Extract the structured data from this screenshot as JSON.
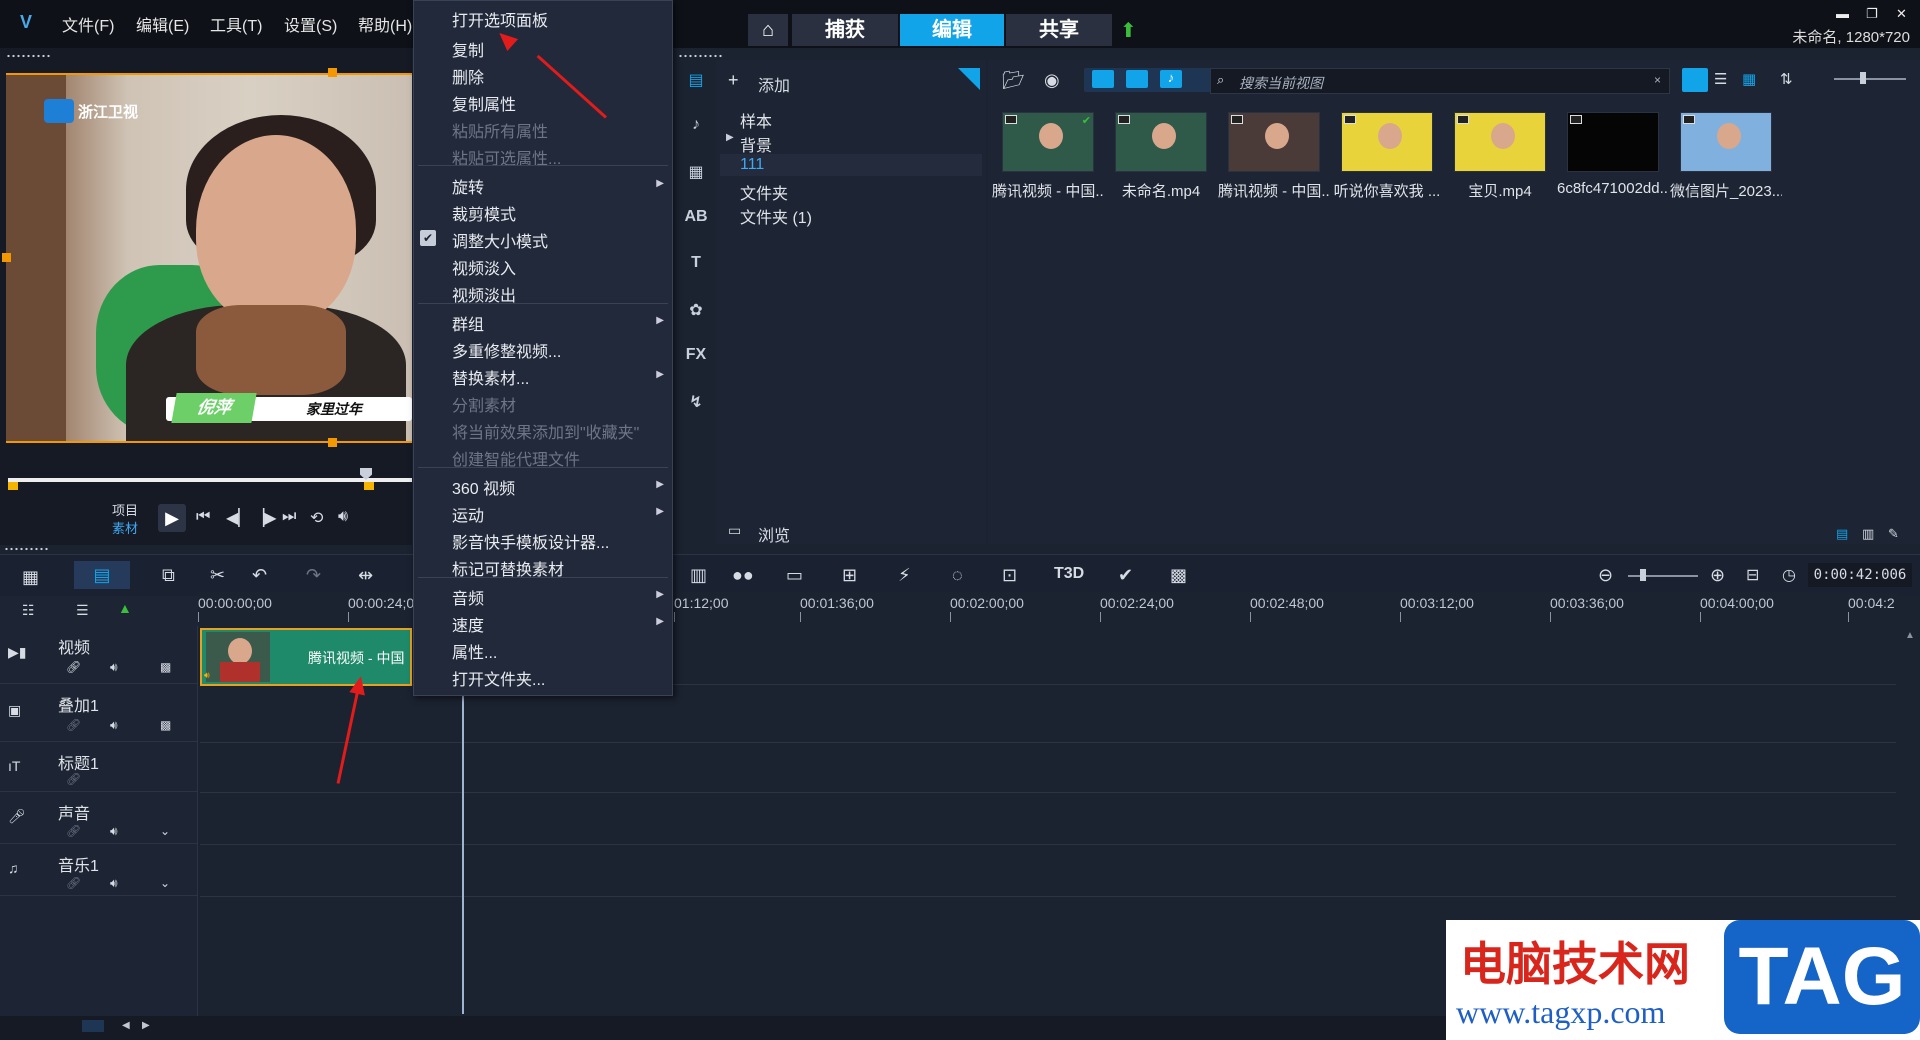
{
  "menubar": {
    "items": [
      "文件(F)",
      "编辑(E)",
      "工具(T)",
      "设置(S)",
      "帮助(H)"
    ]
  },
  "tabs": {
    "capture": "捕获",
    "edit": "编辑",
    "share": "共享"
  },
  "window": {
    "status": "未命名, 1280*720"
  },
  "preview": {
    "station": "浙江卫视",
    "caption_name": "倪萍",
    "caption_text": "家里过年",
    "label_project": "项目",
    "label_clip": "素材"
  },
  "context_menu": {
    "items": [
      {
        "label": "打开选项面板",
        "disabled": false
      },
      {
        "label": "复制",
        "disabled": false
      },
      {
        "label": "删除",
        "disabled": false
      },
      {
        "label": "复制属性",
        "disabled": false
      },
      {
        "label": "粘贴所有属性",
        "disabled": true
      },
      {
        "label": "粘贴可选属性...",
        "disabled": true
      },
      {
        "label": "旋转",
        "disabled": false,
        "submenu": true
      },
      {
        "label": "裁剪模式",
        "disabled": false
      },
      {
        "label": "调整大小模式",
        "disabled": false,
        "checked": true
      },
      {
        "label": "视频淡入",
        "disabled": false
      },
      {
        "label": "视频淡出",
        "disabled": false
      },
      {
        "label": "群组",
        "disabled": false,
        "submenu": true
      },
      {
        "label": "多重修整视频...",
        "disabled": false
      },
      {
        "label": "替换素材...",
        "disabled": false,
        "submenu": true
      },
      {
        "label": "分割素材",
        "disabled": true
      },
      {
        "label": "将当前效果添加到\"收藏夹\"",
        "disabled": true
      },
      {
        "label": "创建智能代理文件",
        "disabled": true
      },
      {
        "label": "360 视频",
        "disabled": false,
        "submenu": true
      },
      {
        "label": "运动",
        "disabled": false,
        "submenu": true
      },
      {
        "label": "影音快手模板设计器...",
        "disabled": false
      },
      {
        "label": "标记可替换素材",
        "disabled": false
      },
      {
        "label": "音频",
        "disabled": false,
        "submenu": true
      },
      {
        "label": "速度",
        "disabled": false,
        "submenu": true
      },
      {
        "label": "属性...",
        "disabled": false
      },
      {
        "label": "打开文件夹...",
        "disabled": false
      }
    ]
  },
  "library": {
    "add_label": "添加",
    "browse_label": "浏览",
    "folders": [
      "样本",
      "背景",
      "111",
      "文件夹",
      "文件夹 (1)"
    ],
    "selected_folder": "111",
    "search_placeholder": "搜索当前视图",
    "media": [
      {
        "name": "腾讯视频 - 中国...",
        "kind": "video",
        "checked": true
      },
      {
        "name": "未命名.mp4",
        "kind": "video"
      },
      {
        "name": "腾讯视频 - 中国...",
        "kind": "video"
      },
      {
        "name": "听说你喜欢我 ...",
        "kind": "video"
      },
      {
        "name": "宝贝.mp4",
        "kind": "video"
      },
      {
        "name": "6c8fc471002dd...",
        "kind": "video"
      },
      {
        "name": "微信图片_2023...",
        "kind": "image"
      }
    ]
  },
  "timeline": {
    "timecode": "0:00:42:006",
    "ruler": [
      "00:00:00;00",
      "00:00:24;0",
      "01:12;00",
      "00:01:36;00",
      "00:02:00;00",
      "00:02:24;00",
      "00:02:48;00",
      "00:03:12;00",
      "00:03:36;00",
      "00:04:00;00",
      "00:04:2"
    ],
    "tracks": [
      "视频",
      "叠加1",
      "标题1",
      "声音",
      "音乐1"
    ],
    "clip_label": "腾讯视频 - 中国"
  },
  "watermark": {
    "site_name": "电脑技术网",
    "url": "www.tagxp.com",
    "tag": "TAG"
  },
  "colors": {
    "accent": "#12a4e8",
    "selection": "#f39800",
    "clip": "#1e8a6a",
    "annotation_arrow": "#e21b1b"
  }
}
